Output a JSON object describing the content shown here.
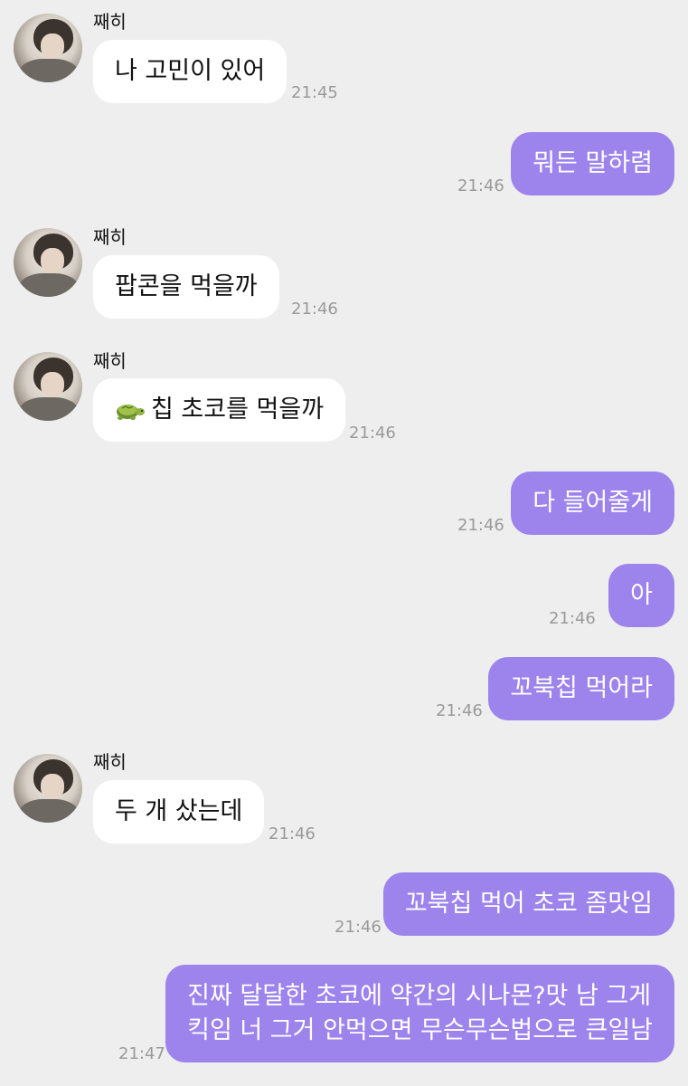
{
  "messages": [
    {
      "side": "in",
      "sender": "째히",
      "text": "나 고민이 있어",
      "time": "21:45"
    },
    {
      "side": "out",
      "text": "뭐든 말하렴",
      "time": "21:46"
    },
    {
      "side": "in",
      "sender": "째히",
      "text": "팝콘을 먹을까",
      "time": "21:46"
    },
    {
      "side": "in",
      "sender": "째히",
      "text": "칩 초코를 먹을까",
      "emoji": "turtle-icon",
      "time": "21:46"
    },
    {
      "side": "out",
      "text": "다 들어줄게",
      "time": "21:46"
    },
    {
      "side": "out",
      "text": "아",
      "time": "21:46"
    },
    {
      "side": "out",
      "text": "꼬북칩 먹어라",
      "time": "21:46"
    },
    {
      "side": "in",
      "sender": "째히",
      "text": "두 개 샀는데",
      "time": "21:46"
    },
    {
      "side": "out",
      "text": "꼬북칩 먹어 초코 좀맛임",
      "time": "21:46"
    },
    {
      "side": "out",
      "lines": [
        "진짜 달달한 초코에 약간의 시나몬?맛 남 그게",
        "킥임 너 그거 안먹으면 무슨무슨법으로 큰일남"
      ],
      "time": "21:47"
    }
  ],
  "colors": {
    "background": "#eeeeee",
    "incoming": "#ffffff",
    "outgoing": "#9d83ec",
    "time": "#9a9a9a"
  }
}
